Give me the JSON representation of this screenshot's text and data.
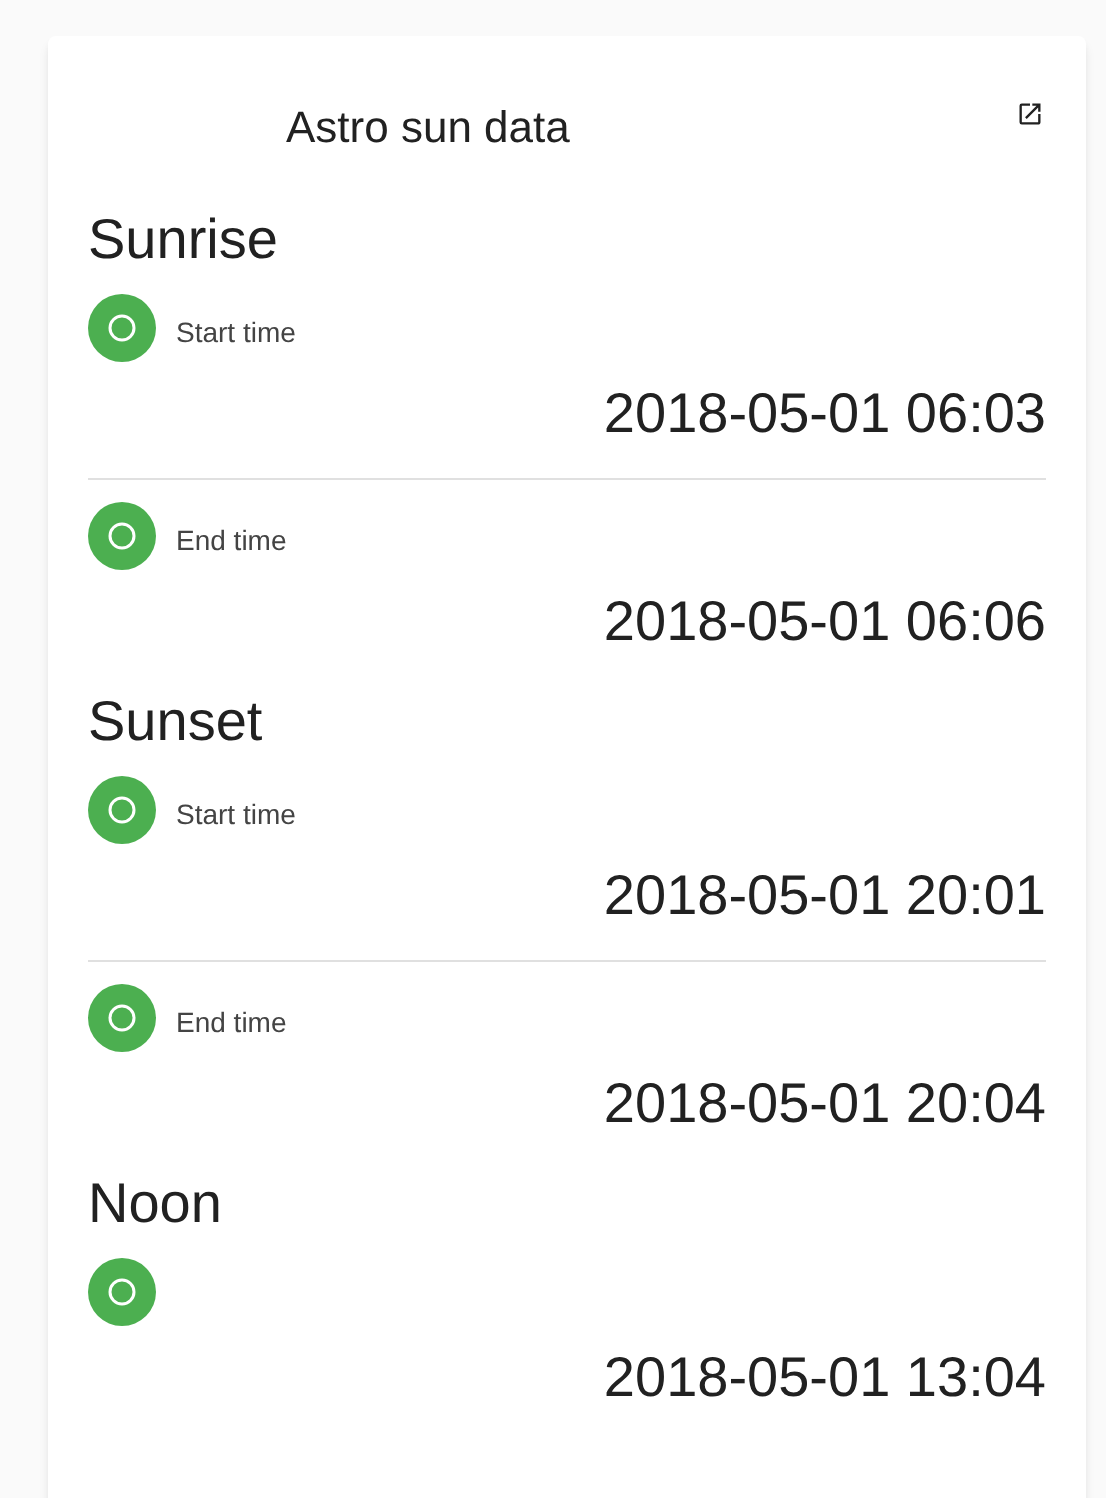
{
  "card": {
    "title": "Astro sun data"
  },
  "sections": [
    {
      "heading": "Sunrise",
      "rows": [
        {
          "label": "Start time",
          "value": "2018-05-01 06:03"
        },
        {
          "label": "End time",
          "value": "2018-05-01 06:06"
        }
      ]
    },
    {
      "heading": "Sunset",
      "rows": [
        {
          "label": "Start time",
          "value": "2018-05-01 20:01"
        },
        {
          "label": "End time",
          "value": "2018-05-01 20:04"
        }
      ]
    },
    {
      "heading": "Noon",
      "rows": [
        {
          "value": "2018-05-01 13:04"
        }
      ]
    }
  ]
}
